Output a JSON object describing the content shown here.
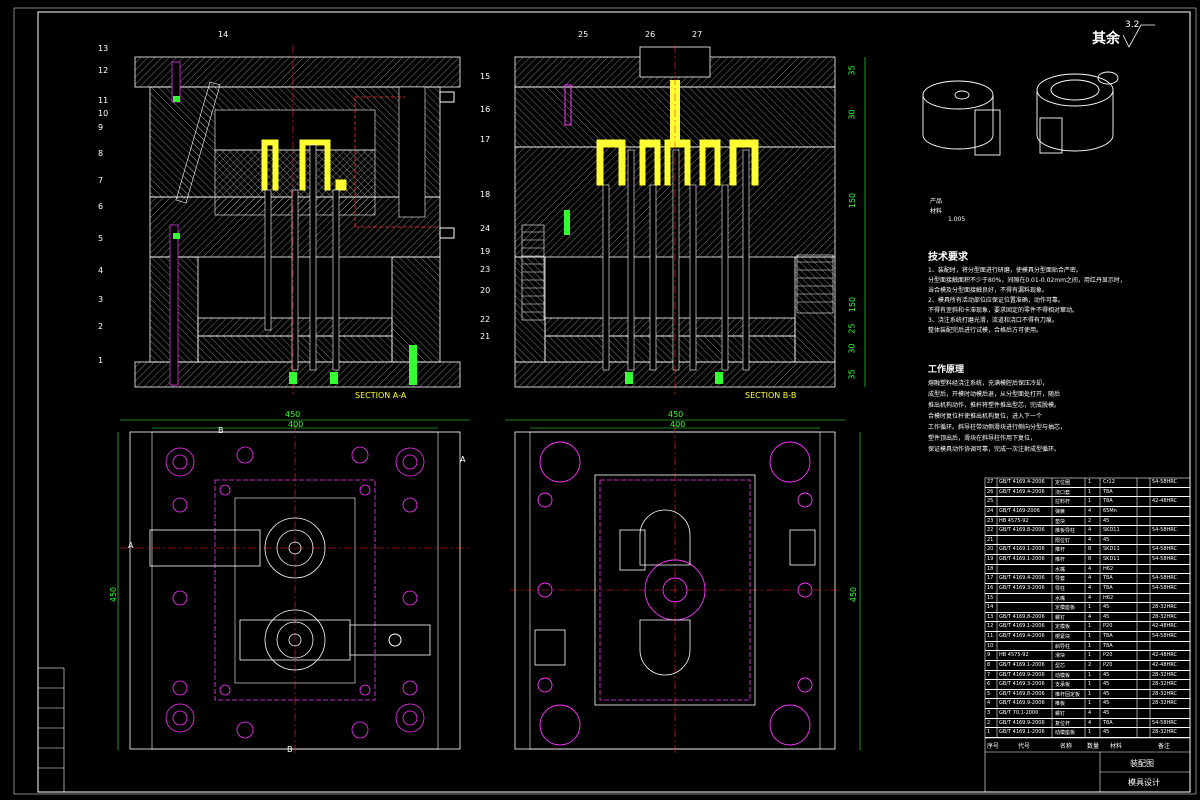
{
  "title_block": {
    "roughness_label": "其余",
    "roughness_value": "3.2",
    "product_name": "产品",
    "material": "材料",
    "shrinkage": "1.005"
  },
  "sections": {
    "a_label": "SECTION A-A",
    "b_label": "SECTION B-B",
    "cut_a": "A",
    "cut_b": "B"
  },
  "part_numbers_left": [
    "13",
    "12",
    "11",
    "10",
    "9",
    "8",
    "7",
    "6",
    "5",
    "4",
    "3",
    "2",
    "1"
  ],
  "part_numbers_top": [
    "14",
    "25",
    "26",
    "27"
  ],
  "part_numbers_mid": [
    "15",
    "16",
    "17",
    "18",
    "19",
    "20",
    "24",
    "23",
    "22",
    "21"
  ],
  "dims": {
    "sec_b_heights": [
      "35",
      "30",
      "150",
      "150",
      "25",
      "30",
      "35"
    ],
    "plan_width_outer": "450",
    "plan_width_inner": "400",
    "plan_height": "450"
  },
  "notes": {
    "tech_title": "技术要求",
    "tech_lines": [
      "1、装配时，将分型面进行研磨，使模具分型面贴合严密。",
      "分型面接触面积不少于80%，间隙在0.01-0.02mm之间，用红丹显示时，",
      "当合模及分型面接触良好，不得有漏料现象。",
      "2、模具所有活动部位应保证位置准确，动作可靠。",
      "不得有歪斜和卡滞现象，要求固定的零件不得相对窜动。",
      "3、浇注系统打磨光滑，流道和浇口不得有刀痕。",
      "整体装配完后进行试模，合格后方可使用。"
    ],
    "work_title": "工作原理",
    "work_lines": [
      "熔融塑料经浇注系统，充满模腔后保压冷却，",
      "成型后，开模时动模后退，从分型面处打开，随后",
      "推出机构动作，推杆将塑件推出型芯，完成脱模。",
      "合模时复位杆使推出机构复位，进入下一个",
      "工作循环。斜导柱带动侧滑块进行侧向分型与抽芯，",
      "塑件顶出后，滑块在斜导柱作用下复位，",
      "保证模具动作协调可靠，完成一次注射成型循环。"
    ]
  },
  "bom": {
    "rows": [
      {
        "no": "27",
        "std": "GB/T 4169.4-2006",
        "name": "定位圈",
        "qty": "1",
        "mat": "Cr12",
        "note": "54-58HRC"
      },
      {
        "no": "26",
        "std": "GB/T 4169.4-2006",
        "name": "浇口套",
        "qty": "1",
        "mat": "T8A",
        "note": ""
      },
      {
        "no": "25",
        "std": "",
        "name": "拉料杆",
        "qty": "1",
        "mat": "T8A",
        "note": "42-48HRC"
      },
      {
        "no": "24",
        "std": "GB/T 4169-2006",
        "name": "弹簧",
        "qty": "4",
        "mat": "65Mn",
        "note": ""
      },
      {
        "no": "23",
        "std": "HB 4575-92",
        "name": "垫块",
        "qty": "2",
        "mat": "45",
        "note": ""
      },
      {
        "no": "22",
        "std": "GB/T 4169.8-2006",
        "name": "推板导柱",
        "qty": "4",
        "mat": "SKD11",
        "note": "54-58HRC"
      },
      {
        "no": "21",
        "std": "",
        "name": "限位钉",
        "qty": "4",
        "mat": "45",
        "note": ""
      },
      {
        "no": "20",
        "std": "GB/T 4169.1-2006",
        "name": "推杆",
        "qty": "8",
        "mat": "SKD11",
        "note": "54-58HRC"
      },
      {
        "no": "19",
        "std": "GB/T 4169.1-2006",
        "name": "推杆",
        "qty": "8",
        "mat": "SKD11",
        "note": "54-58HRC"
      },
      {
        "no": "18",
        "std": "",
        "name": "水嘴",
        "qty": "4",
        "mat": "H62",
        "note": ""
      },
      {
        "no": "17",
        "std": "GB/T 4169.4-2006",
        "name": "导套",
        "qty": "4",
        "mat": "T8A",
        "note": "54-58HRC"
      },
      {
        "no": "16",
        "std": "GB/T 4169.3-2006",
        "name": "导柱",
        "qty": "4",
        "mat": "T8A",
        "note": "54-58HRC"
      },
      {
        "no": "15",
        "std": "",
        "name": "水嘴",
        "qty": "4",
        "mat": "H62",
        "note": ""
      },
      {
        "no": "14",
        "std": "",
        "name": "定模座板",
        "qty": "1",
        "mat": "45",
        "note": "28-32HRC"
      },
      {
        "no": "13",
        "std": "GB/T 4169.8-2006",
        "name": "螺钉",
        "qty": "4",
        "mat": "45",
        "note": "28-32HRC"
      },
      {
        "no": "12",
        "std": "GB/T 4169.1-2006",
        "name": "定模板",
        "qty": "1",
        "mat": "P20",
        "note": "42-48HRC"
      },
      {
        "no": "11",
        "std": "GB/T 4169.4-2006",
        "name": "楔紧块",
        "qty": "1",
        "mat": "T8A",
        "note": "54-58HRC"
      },
      {
        "no": "10",
        "std": "",
        "name": "斜导柱",
        "qty": "1",
        "mat": "T8A",
        "note": ""
      },
      {
        "no": "9",
        "std": "HB 4575-92",
        "name": "滑块",
        "qty": "1",
        "mat": "P20",
        "note": "42-48HRC"
      },
      {
        "no": "8",
        "std": "GB/T 4169.1-2006",
        "name": "型芯",
        "qty": "2",
        "mat": "P20",
        "note": "42-48HRC"
      },
      {
        "no": "7",
        "std": "GB/T 4169.9-2006",
        "name": "动模板",
        "qty": "1",
        "mat": "45",
        "note": "28-32HRC"
      },
      {
        "no": "6",
        "std": "GB/T 4169.3-2006",
        "name": "支承板",
        "qty": "1",
        "mat": "45",
        "note": "28-32HRC"
      },
      {
        "no": "5",
        "std": "GB/T 4169.8-2006",
        "name": "推杆固定板",
        "qty": "1",
        "mat": "45",
        "note": "28-32HRC"
      },
      {
        "no": "4",
        "std": "GB/T 4169.9-2006",
        "name": "推板",
        "qty": "1",
        "mat": "45",
        "note": "28-32HRC"
      },
      {
        "no": "3",
        "std": "GB/T 70.1-2000",
        "name": "螺钉",
        "qty": "4",
        "mat": "45",
        "note": ""
      },
      {
        "no": "2",
        "std": "GB/T 4169.9-2006",
        "name": "复位杆",
        "qty": "4",
        "mat": "T8A",
        "note": "54-58HRC"
      },
      {
        "no": "1",
        "std": "GB/T 4169.1-2006",
        "name": "动模座板",
        "qty": "1",
        "mat": "45",
        "note": "28-32HRC"
      }
    ],
    "header": {
      "no": "序号",
      "std": "代号",
      "name": "名称",
      "qty": "数量",
      "mat": "材料",
      "note": "备注"
    },
    "drawing_title": "装配图",
    "drawing_sub": "模具设计"
  },
  "colors": {
    "background": "#000000",
    "line": "#ffffff",
    "hatch": "#d9d9d9",
    "centerline": "#ff2a2a",
    "magenta": "#ff33ff",
    "yellow": "#ffff33",
    "green": "#33ff33",
    "cyan": "#33ffff"
  }
}
